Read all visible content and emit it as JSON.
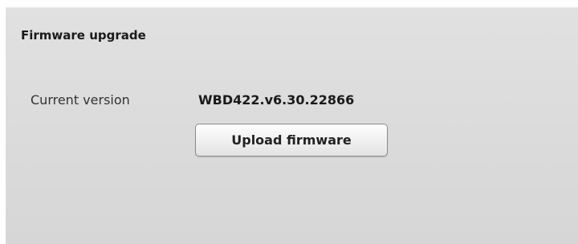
{
  "section": {
    "title": "Firmware upgrade"
  },
  "current_version": {
    "label": "Current version",
    "value": "WBD422.v6.30.22866"
  },
  "upload_button": {
    "label": "Upload firmware"
  }
}
